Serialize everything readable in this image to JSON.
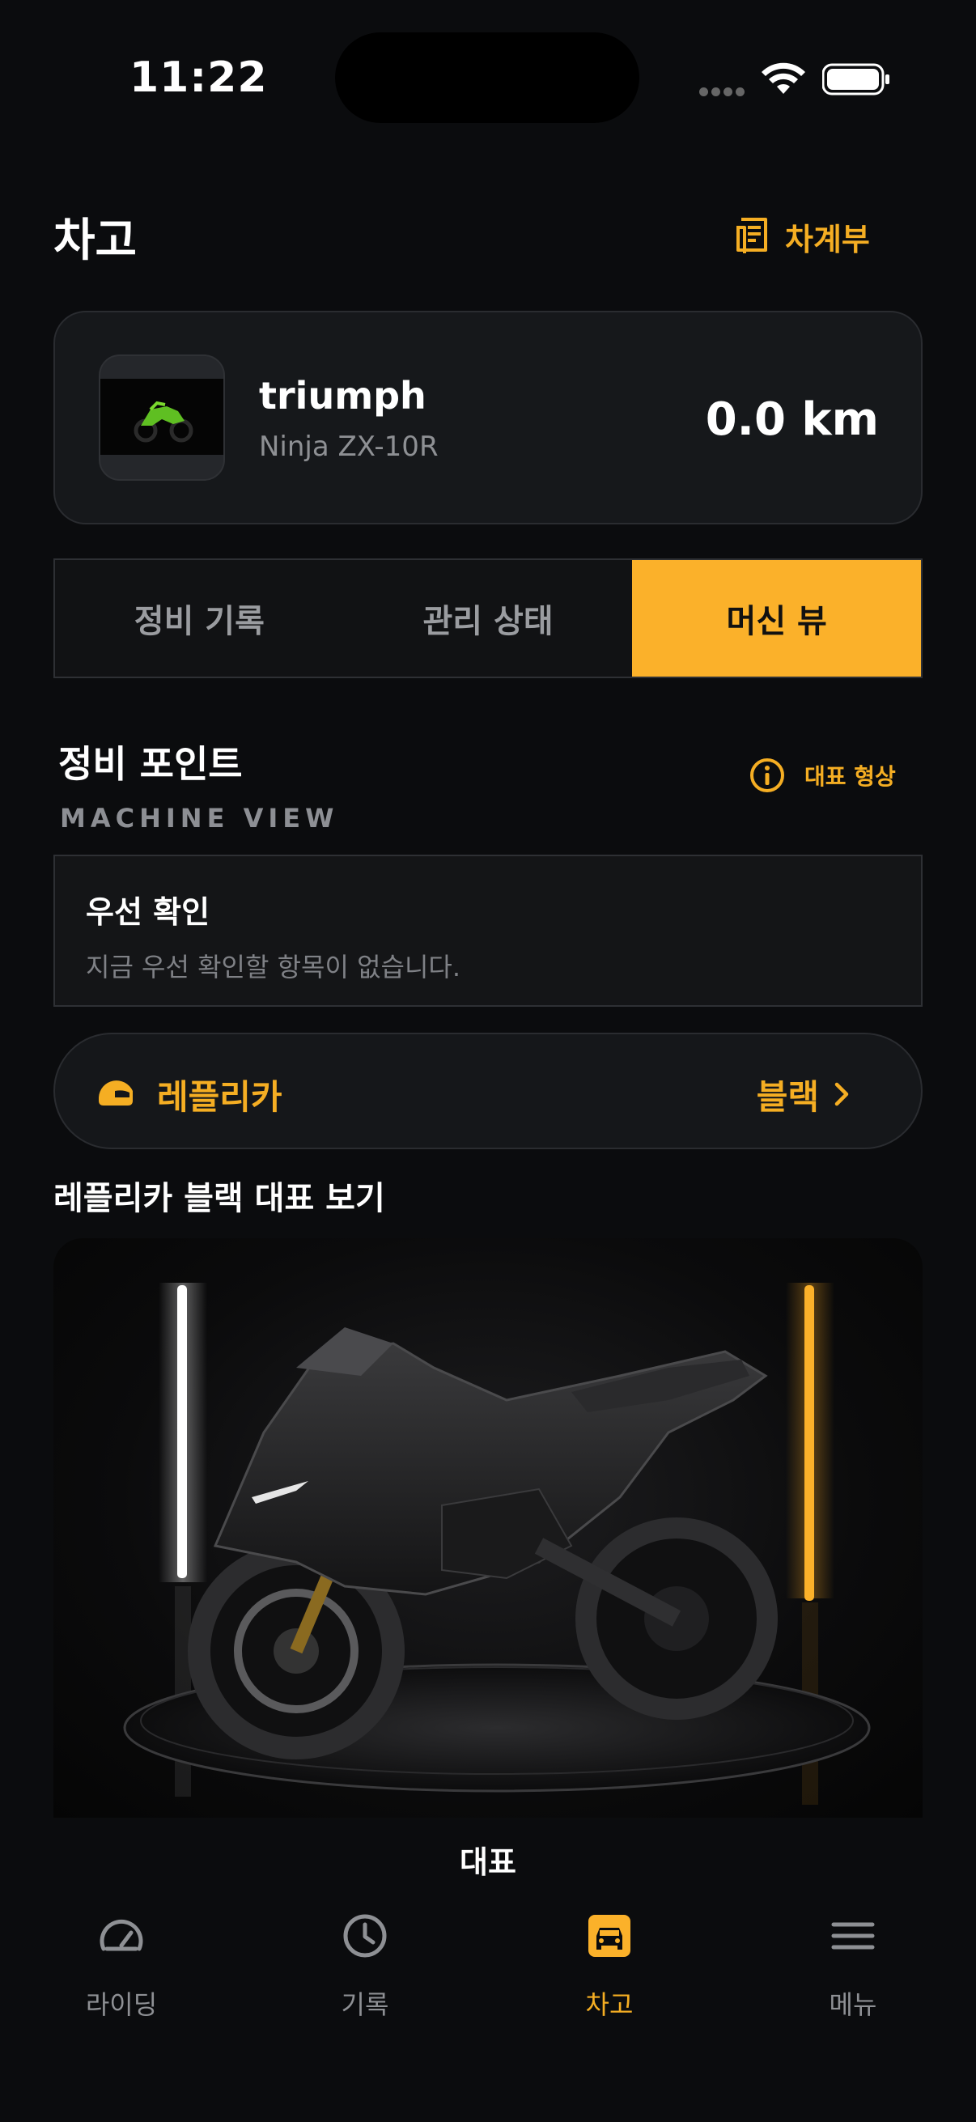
{
  "status_bar": {
    "time": "11:22"
  },
  "header": {
    "title": "차고",
    "ledger_label": "차계부"
  },
  "vehicle": {
    "name": "triumph",
    "model": "Ninja ZX-10R",
    "distance": "0.0 km"
  },
  "tabs": [
    {
      "label": "정비 기록",
      "active": false
    },
    {
      "label": "관리 상태",
      "active": false
    },
    {
      "label": "머신 뷰",
      "active": true
    }
  ],
  "section": {
    "title": "정비 포인트",
    "subtitle": "MACHINE VIEW",
    "rep_shape_label": "대표 형상"
  },
  "priority": {
    "title": "우선 확인",
    "description": "지금 우선 확인할 항목이 없습니다."
  },
  "replica": {
    "label": "레플리카",
    "value": "블랙"
  },
  "replica_heading": "레플리카 블랙 대표 보기",
  "image_caption": "대표",
  "bottom_nav": [
    {
      "label": "라이딩",
      "icon": "speedometer-icon",
      "active": false
    },
    {
      "label": "기록",
      "icon": "clock-icon",
      "active": false
    },
    {
      "label": "차고",
      "icon": "car-icon",
      "active": true
    },
    {
      "label": "메뉴",
      "icon": "menu-icon",
      "active": false
    }
  ],
  "colors": {
    "accent": "#fbb12a",
    "background": "#0b0c0e",
    "card": "#16181b"
  }
}
